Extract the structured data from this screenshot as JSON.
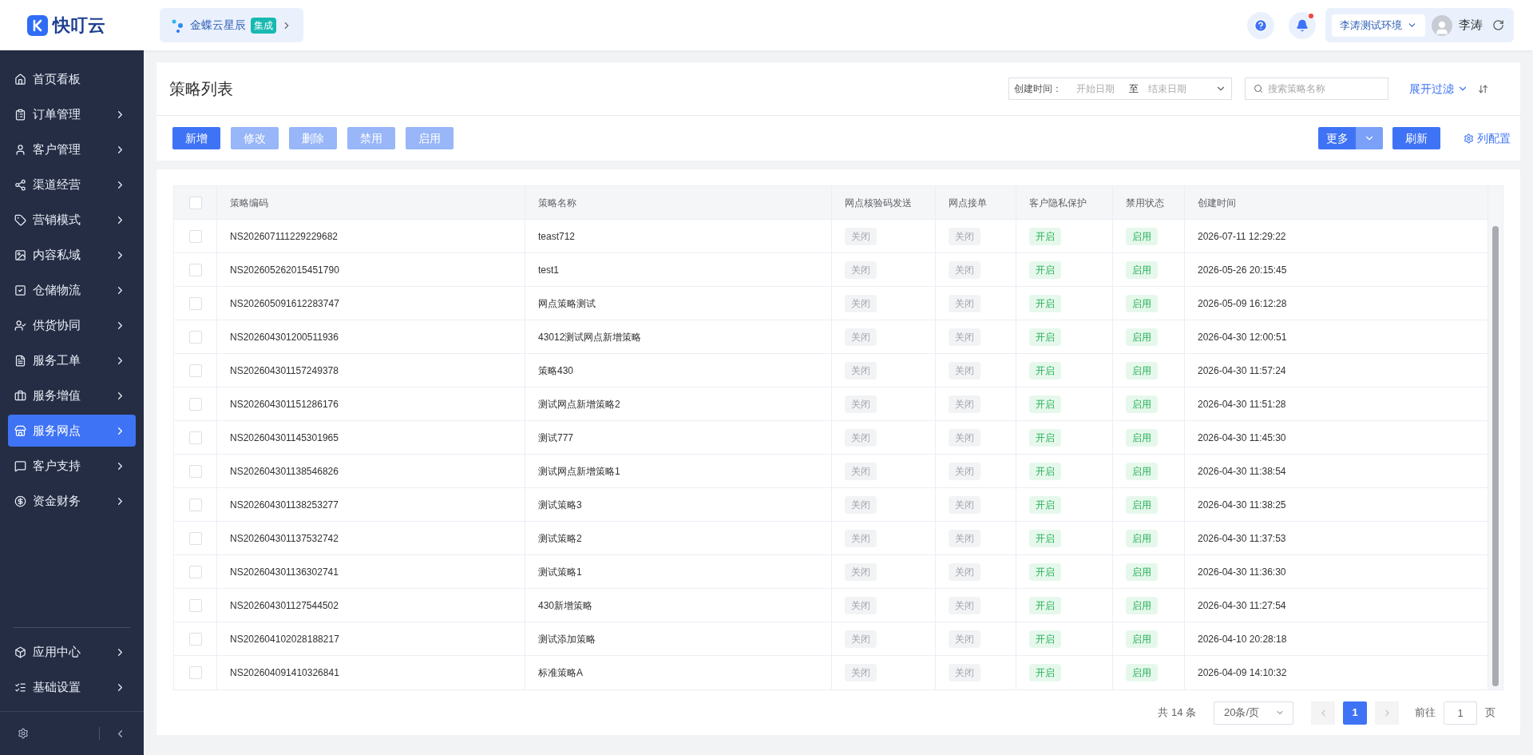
{
  "header": {
    "logo_text": "快叮云",
    "integration": {
      "name": "金蝶云星辰",
      "badge": "集成"
    },
    "has_unread": true,
    "env": "李涛测试环境",
    "user": "李涛"
  },
  "sidebar": {
    "items": [
      {
        "label": "首页看板",
        "selected": false,
        "has_children": false
      },
      {
        "label": "订单管理",
        "selected": false,
        "has_children": true
      },
      {
        "label": "客户管理",
        "selected": false,
        "has_children": true
      },
      {
        "label": "渠道经营",
        "selected": false,
        "has_children": true
      },
      {
        "label": "营销模式",
        "selected": false,
        "has_children": true
      },
      {
        "label": "内容私域",
        "selected": false,
        "has_children": true
      },
      {
        "label": "仓储物流",
        "selected": false,
        "has_children": true
      },
      {
        "label": "供货协同",
        "selected": false,
        "has_children": true
      },
      {
        "label": "服务工单",
        "selected": false,
        "has_children": true
      },
      {
        "label": "服务增值",
        "selected": false,
        "has_children": true
      },
      {
        "label": "服务网点",
        "selected": true,
        "has_children": true
      },
      {
        "label": "客户支持",
        "selected": false,
        "has_children": true
      },
      {
        "label": "资金财务",
        "selected": false,
        "has_children": true
      }
    ],
    "bottom_items": [
      {
        "label": "应用中心",
        "selected": false,
        "has_children": true
      },
      {
        "label": "基础设置",
        "selected": false,
        "has_children": true
      }
    ]
  },
  "page": {
    "title": "策略列表",
    "filter": {
      "label": "创建时间：",
      "start_placeholder": "开始日期",
      "separator": "至",
      "end_placeholder": "结束日期"
    },
    "search_placeholder": "搜索策略名称",
    "expand_filter": "展开过滤",
    "toolbar": [
      {
        "label": "新增",
        "disabled": false
      },
      {
        "label": "修改",
        "disabled": true
      },
      {
        "label": "删除",
        "disabled": true
      },
      {
        "label": "禁用",
        "disabled": true
      },
      {
        "label": "启用",
        "disabled": true
      }
    ],
    "more": "更多",
    "refresh": "刷新",
    "column_config": "列配置"
  },
  "table": {
    "all_checked": false,
    "columns": [
      "策略编码",
      "策略名称",
      "网点核验码发送",
      "网点接单",
      "客户隐私保护",
      "禁用状态",
      "创建时间"
    ],
    "rows": [
      {
        "checked": false,
        "code": "NS202607111229229682",
        "name": "teast712",
        "verify": {
          "text": "关闭",
          "on": false
        },
        "accept": {
          "text": "关闭",
          "on": false
        },
        "privacy": {
          "text": "开启",
          "on": true
        },
        "status": {
          "text": "启用",
          "on": true
        },
        "created": "2026-07-11 12:29:22"
      },
      {
        "checked": false,
        "code": "NS202605262015451790",
        "name": "test1",
        "verify": {
          "text": "关闭",
          "on": false
        },
        "accept": {
          "text": "关闭",
          "on": false
        },
        "privacy": {
          "text": "开启",
          "on": true
        },
        "status": {
          "text": "启用",
          "on": true
        },
        "created": "2026-05-26 20:15:45"
      },
      {
        "checked": false,
        "code": "NS202605091612283747",
        "name": "网点策略测试",
        "verify": {
          "text": "关闭",
          "on": false
        },
        "accept": {
          "text": "关闭",
          "on": false
        },
        "privacy": {
          "text": "开启",
          "on": true
        },
        "status": {
          "text": "启用",
          "on": true
        },
        "created": "2026-05-09 16:12:28"
      },
      {
        "checked": false,
        "code": "NS202604301200511936",
        "name": "43012测试网点新增策略",
        "verify": {
          "text": "关闭",
          "on": false
        },
        "accept": {
          "text": "关闭",
          "on": false
        },
        "privacy": {
          "text": "开启",
          "on": true
        },
        "status": {
          "text": "启用",
          "on": true
        },
        "created": "2026-04-30 12:00:51"
      },
      {
        "checked": false,
        "code": "NS202604301157249378",
        "name": "策略430",
        "verify": {
          "text": "关闭",
          "on": false
        },
        "accept": {
          "text": "关闭",
          "on": false
        },
        "privacy": {
          "text": "开启",
          "on": true
        },
        "status": {
          "text": "启用",
          "on": true
        },
        "created": "2026-04-30 11:57:24"
      },
      {
        "checked": false,
        "code": "NS202604301151286176",
        "name": "测试网点新增策略2",
        "verify": {
          "text": "关闭",
          "on": false
        },
        "accept": {
          "text": "关闭",
          "on": false
        },
        "privacy": {
          "text": "开启",
          "on": true
        },
        "status": {
          "text": "启用",
          "on": true
        },
        "created": "2026-04-30 11:51:28"
      },
      {
        "checked": false,
        "code": "NS202604301145301965",
        "name": "测试777",
        "verify": {
          "text": "关闭",
          "on": false
        },
        "accept": {
          "text": "关闭",
          "on": false
        },
        "privacy": {
          "text": "开启",
          "on": true
        },
        "status": {
          "text": "启用",
          "on": true
        },
        "created": "2026-04-30 11:45:30"
      },
      {
        "checked": false,
        "code": "NS202604301138546826",
        "name": "测试网点新增策略1",
        "verify": {
          "text": "关闭",
          "on": false
        },
        "accept": {
          "text": "关闭",
          "on": false
        },
        "privacy": {
          "text": "开启",
          "on": true
        },
        "status": {
          "text": "启用",
          "on": true
        },
        "created": "2026-04-30 11:38:54"
      },
      {
        "checked": false,
        "code": "NS202604301138253277",
        "name": "测试策略3",
        "verify": {
          "text": "关闭",
          "on": false
        },
        "accept": {
          "text": "关闭",
          "on": false
        },
        "privacy": {
          "text": "开启",
          "on": true
        },
        "status": {
          "text": "启用",
          "on": true
        },
        "created": "2026-04-30 11:38:25"
      },
      {
        "checked": false,
        "code": "NS202604301137532742",
        "name": "测试策略2",
        "verify": {
          "text": "关闭",
          "on": false
        },
        "accept": {
          "text": "关闭",
          "on": false
        },
        "privacy": {
          "text": "开启",
          "on": true
        },
        "status": {
          "text": "启用",
          "on": true
        },
        "created": "2026-04-30 11:37:53"
      },
      {
        "checked": false,
        "code": "NS202604301136302741",
        "name": "测试策略1",
        "verify": {
          "text": "关闭",
          "on": false
        },
        "accept": {
          "text": "关闭",
          "on": false
        },
        "privacy": {
          "text": "开启",
          "on": true
        },
        "status": {
          "text": "启用",
          "on": true
        },
        "created": "2026-04-30 11:36:30"
      },
      {
        "checked": false,
        "code": "NS202604301127544502",
        "name": "430新增策略",
        "verify": {
          "text": "关闭",
          "on": false
        },
        "accept": {
          "text": "关闭",
          "on": false
        },
        "privacy": {
          "text": "开启",
          "on": true
        },
        "status": {
          "text": "启用",
          "on": true
        },
        "created": "2026-04-30 11:27:54"
      },
      {
        "checked": false,
        "code": "NS202604102028188217",
        "name": "测试添加策略",
        "verify": {
          "text": "关闭",
          "on": false
        },
        "accept": {
          "text": "关闭",
          "on": false
        },
        "privacy": {
          "text": "开启",
          "on": true
        },
        "status": {
          "text": "启用",
          "on": true
        },
        "created": "2026-04-10 20:28:18"
      },
      {
        "checked": false,
        "code": "NS202604091410326841",
        "name": "标准策略A",
        "verify": {
          "text": "关闭",
          "on": false
        },
        "accept": {
          "text": "关闭",
          "on": false
        },
        "privacy": {
          "text": "开启",
          "on": true
        },
        "status": {
          "text": "启用",
          "on": true
        },
        "created": "2026-04-09 14:10:32"
      }
    ]
  },
  "pagination": {
    "total": "共 14 条",
    "page_size": "20条/页",
    "pages": [
      {
        "label": "1",
        "selected": true
      }
    ],
    "goto_label": "前往",
    "goto_value": "1",
    "page_suffix": "页"
  }
}
